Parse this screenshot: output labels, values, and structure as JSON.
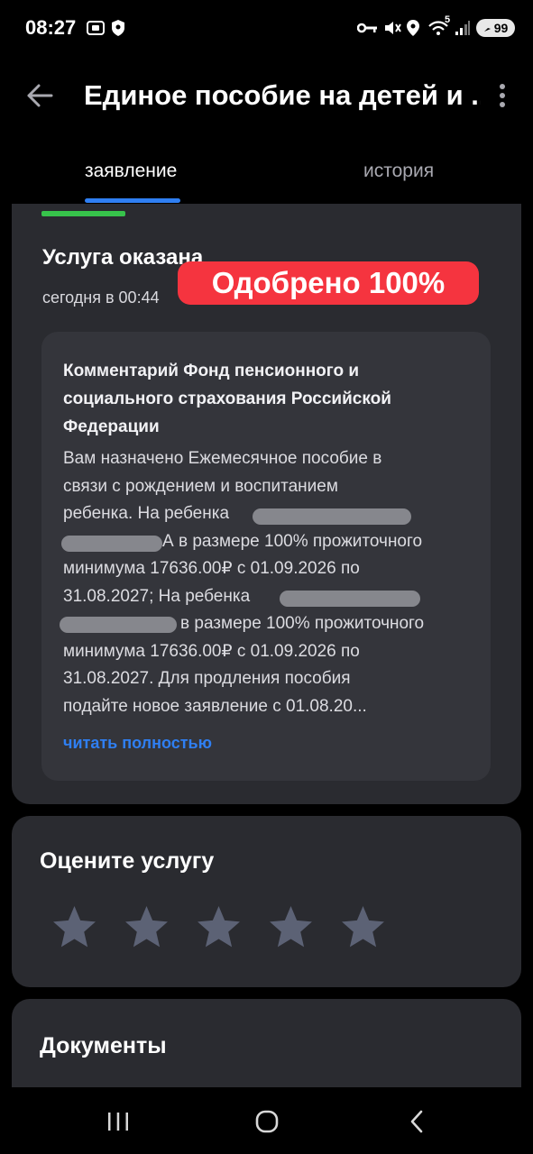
{
  "status_bar": {
    "time": "08:27",
    "network_superscript": "5",
    "battery": "99",
    "icons": [
      "screen-record-icon",
      "shield-icon",
      "key-icon",
      "mute-icon",
      "location-icon",
      "wifi-icon",
      "signal-icon",
      "battery-icon"
    ]
  },
  "header": {
    "title": "Единое пособие на детей и ...",
    "back_icon": "arrow-left-icon",
    "menu_icon": "more-vertical-icon"
  },
  "tabs": [
    {
      "label": "заявление",
      "active": true
    },
    {
      "label": "история",
      "active": false
    }
  ],
  "status_card": {
    "title": "Услуга оказана",
    "time": "сегодня в 00:44",
    "badge": "Одобрено 100%",
    "comment_title": "Комментарий Фонд пенсионного и социального страхования Российской Федерации",
    "comment_lines": [
      "Вам назначено Ежемесячное пособие в",
      "связи с рождением и воспитанием",
      "ребенка. На ребенка",
      "А в размере 100% прожиточного",
      "минимума 17636.00₽ с 01.09.2026 по",
      "31.08.2027; На ребенка",
      "в размере 100% прожиточного",
      "минимума 17636.00₽ с 01.09.2026 по",
      "31.08.2027. Для продления пособия",
      "подайте новое заявление с 01.08.20..."
    ],
    "read_more": "читать полностью"
  },
  "rate_card": {
    "title": "Оцените услугу",
    "stars_total": 5,
    "stars_selected": 0
  },
  "documents_card": {
    "title": "Документы"
  },
  "colors": {
    "background": "#000000",
    "card": "#2a2b30",
    "comment_box": "#34353b",
    "accent_blue": "#2f7ff2",
    "success_green": "#37c34b",
    "badge_red": "#f5343f",
    "star": "#5c6275"
  },
  "navbar": {
    "icons": [
      "recent-apps-icon",
      "home-icon",
      "back-nav-icon"
    ]
  }
}
